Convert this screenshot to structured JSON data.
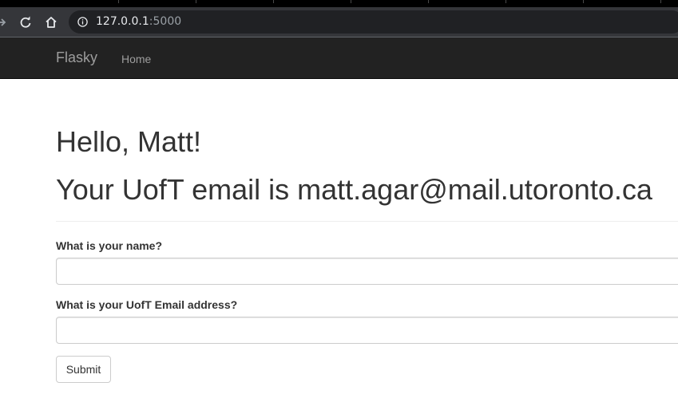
{
  "browser": {
    "url_host": "127.0.0.1",
    "url_port": ":5000"
  },
  "navbar": {
    "brand": "Flasky",
    "links": [
      "Home"
    ]
  },
  "content": {
    "greeting": "Hello, Matt!",
    "email_line": "Your UofT email is matt.agar@mail.utoronto.ca"
  },
  "form": {
    "name_label": "What is your name?",
    "name_value": "",
    "email_label": "What is your UofT Email address?",
    "email_value": "",
    "submit_label": "Submit"
  },
  "colors": {
    "navbar_bg": "#222222",
    "navbar_text": "#9d9d9d",
    "chrome_toolbar": "#35363a",
    "omnibox": "#202124"
  }
}
